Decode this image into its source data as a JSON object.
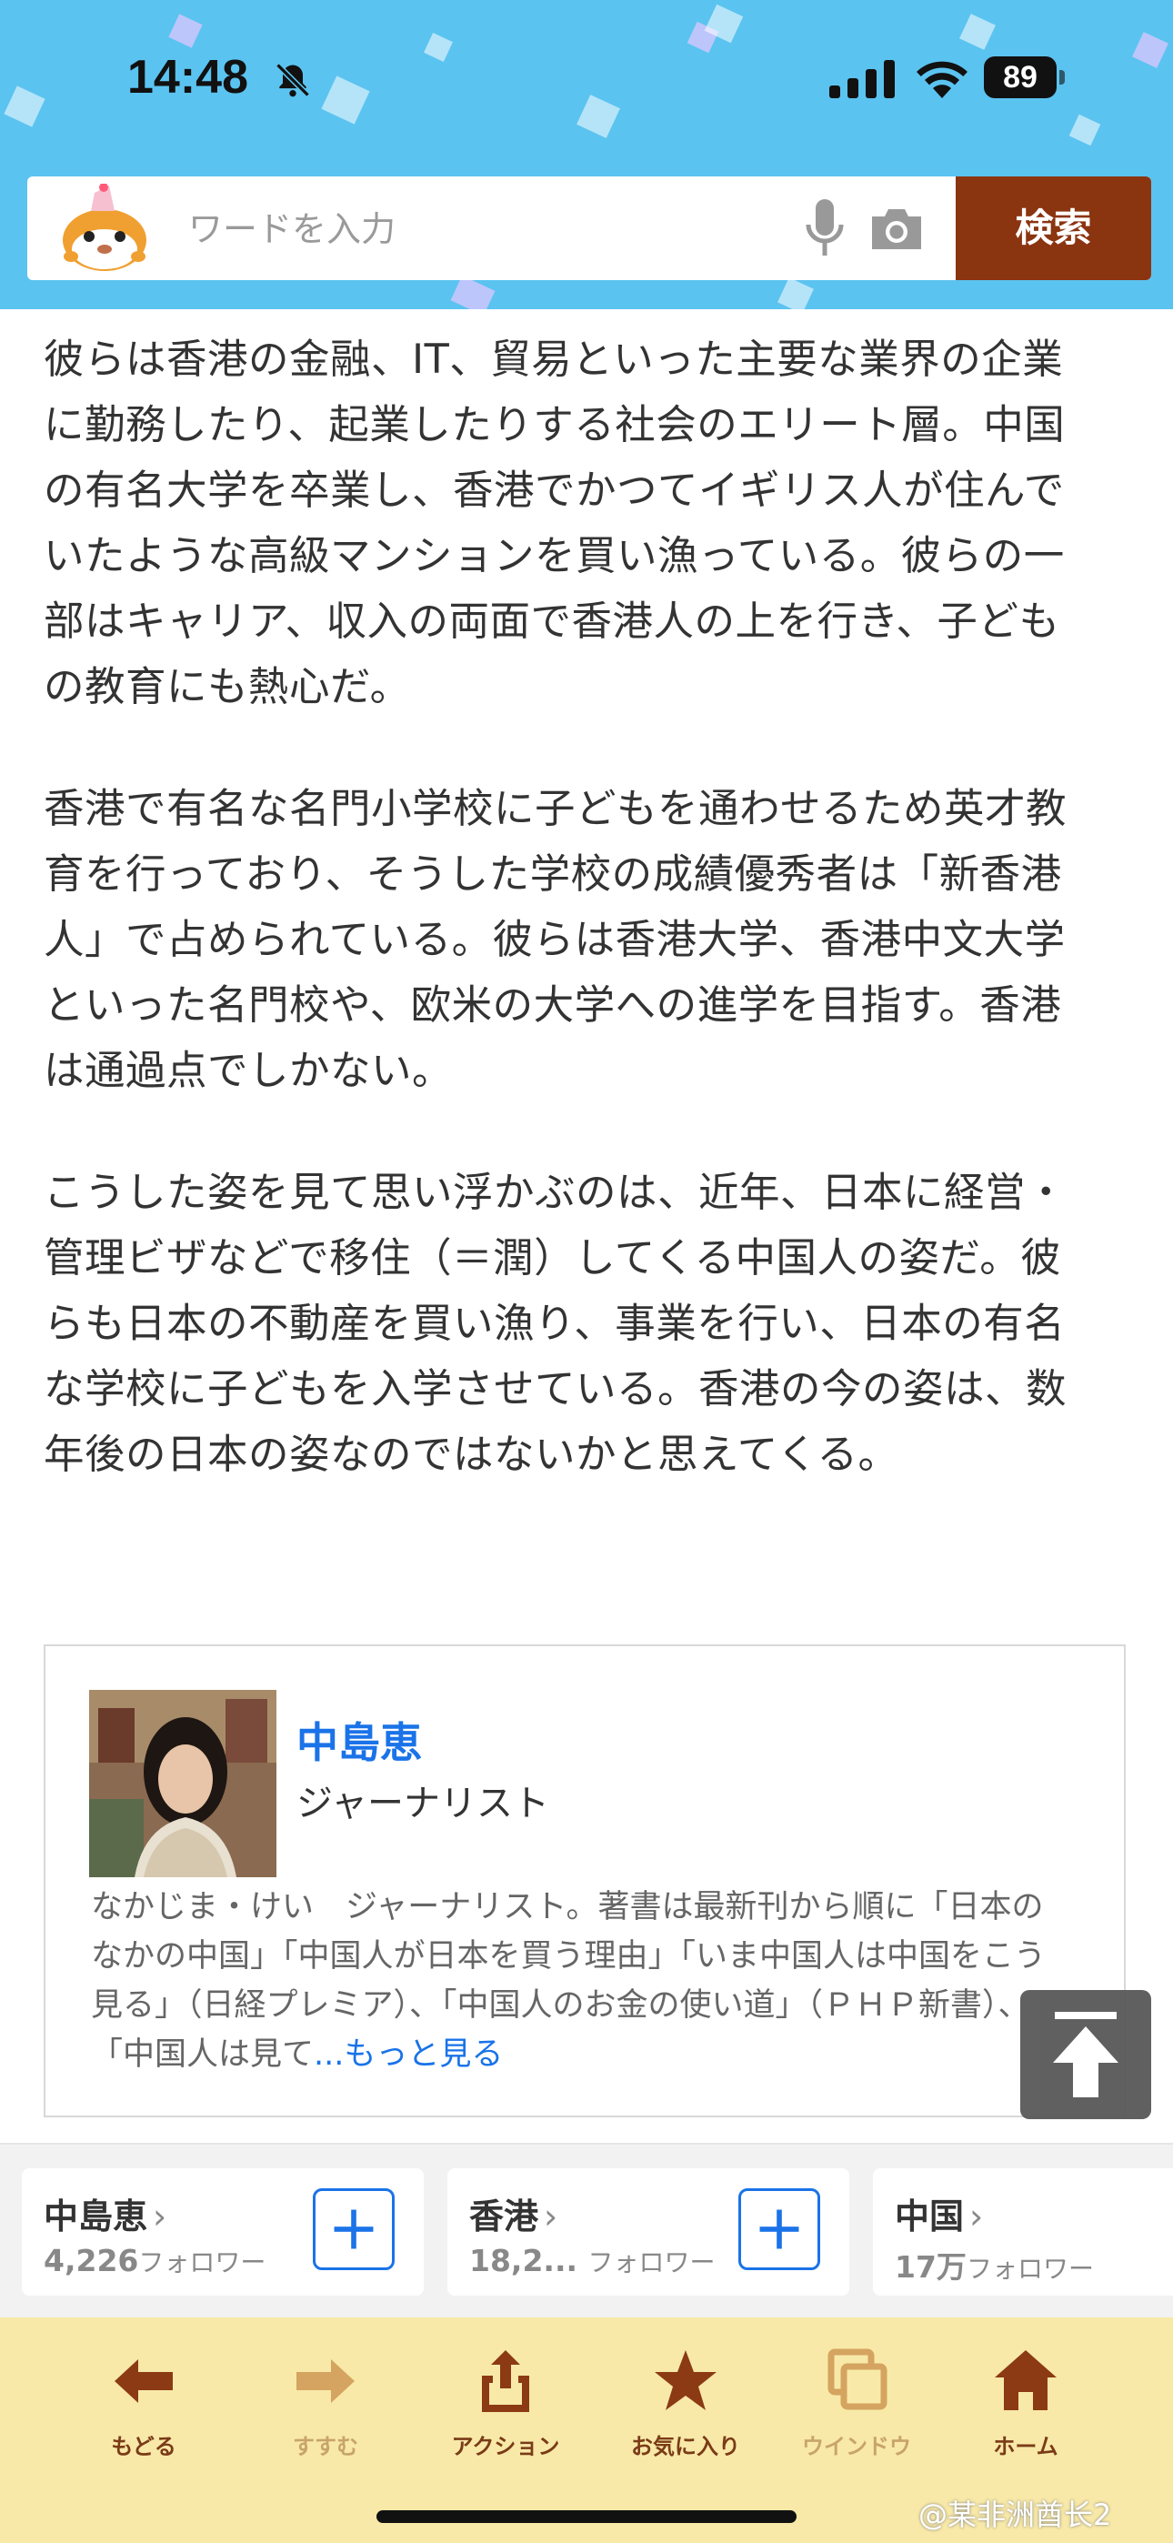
{
  "status_bar": {
    "time": "14:48",
    "battery": "89"
  },
  "search": {
    "placeholder": "ワードを入力",
    "button_label": "検索"
  },
  "article": {
    "paragraphs": [
      "彼らは香港の金融、IT、貿易といった主要な業界の企業に勤務したり、起業したりする社会のエリート層。中国の有名大学を卒業し、香港でかつてイギリス人が住んでいたような高級マンションを買い漁っている。彼らの一部はキャリア、収入の両面で香港人の上を行き、子どもの教育にも熱心だ。",
      "香港で有名な名門小学校に子どもを通わせるため英才教育を行っており、そうした学校の成績優秀者は「新香港人」で占められている。彼らは香港大学、香港中文大学といった名門校や、欧米の大学への進学を目指す。香港は通過点でしかない。",
      "こうした姿を見て思い浮かぶのは、近年、日本に経営・管理ビザなどで移住（＝潤）してくる中国人の姿だ。彼らも日本の不動産を買い漁り、事業を行い、日本の有名な学校に子どもを入学させている。香港の今の姿は、数年後の日本の姿なのではないかと思えてくる。"
    ]
  },
  "author": {
    "name": "中島恵",
    "role": "ジャーナリスト",
    "bio": "なかじま・けい　ジャーナリスト。著書は最新刊から順に「日本のなかの中国」「中国人が日本を買う理由」「いま中国人は中国をこう見る」（日経プレミア）、「中国人のお金の使い道」（ＰＨＰ新書）、「中国人は見て",
    "more_link": "...もっと見る"
  },
  "follow_cards": [
    {
      "name": "中島恵",
      "count": "4,226",
      "unit": "フォロワー"
    },
    {
      "name": "香港",
      "count": "18,2...",
      "unit": "フォロワー"
    },
    {
      "name": "中国",
      "count": "17万",
      "unit": "フォロワー"
    }
  ],
  "toolbar": {
    "back": "もどる",
    "forward": "すすむ",
    "action": "アクション",
    "favorites": "お気に入り",
    "window": "ウインドウ",
    "home": "ホーム"
  },
  "watermark": "@某非洲酋长2",
  "colors": {
    "header_bg": "#5bc3f0",
    "search_button": "#8b3410",
    "link": "#1a73e8",
    "toolbar_bg": "#f8e9a8"
  }
}
